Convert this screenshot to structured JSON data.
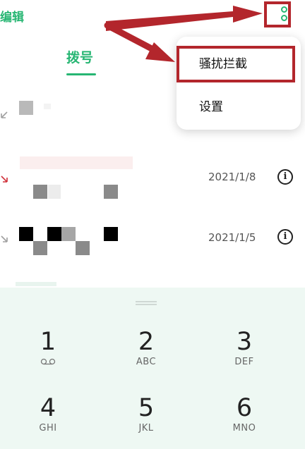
{
  "header": {
    "edit_label": "编辑",
    "tab_dial": "拨号"
  },
  "menu": {
    "items": [
      {
        "label": "骚扰拦截"
      },
      {
        "label": "设置"
      }
    ]
  },
  "calls": [
    {
      "date": ""
    },
    {
      "date": "2021/1/8"
    },
    {
      "date": "2021/1/5"
    }
  ],
  "dialpad": {
    "keys": [
      {
        "num": "1",
        "letters": ""
      },
      {
        "num": "2",
        "letters": "ABC"
      },
      {
        "num": "3",
        "letters": "DEF"
      },
      {
        "num": "4",
        "letters": "GHI"
      },
      {
        "num": "5",
        "letters": "JKL"
      },
      {
        "num": "6",
        "letters": "MNO"
      }
    ]
  },
  "colors": {
    "accent": "#27b673",
    "highlight": "#b3262c",
    "missed": "#d0303a"
  }
}
